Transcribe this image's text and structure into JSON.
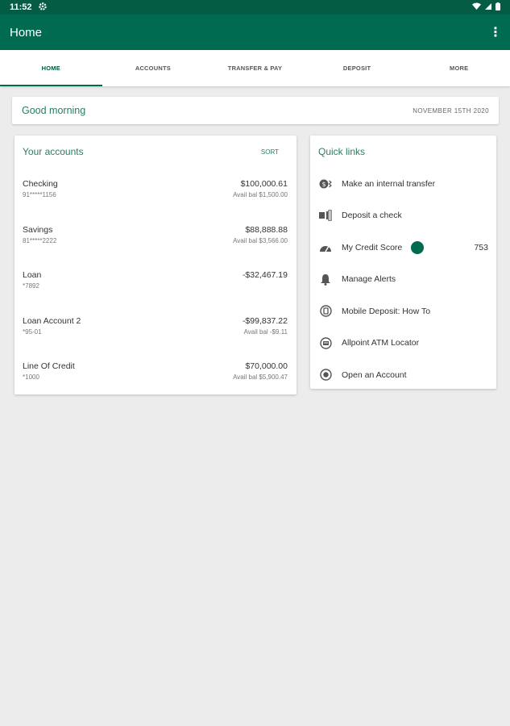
{
  "status_bar": {
    "time": "11:52"
  },
  "app_bar": {
    "title": "Home"
  },
  "tabs": [
    {
      "label": "HOME",
      "active": true
    },
    {
      "label": "ACCOUNTS"
    },
    {
      "label": "TRANSFER & PAY"
    },
    {
      "label": "DEPOSIT"
    },
    {
      "label": "MORE"
    }
  ],
  "greeting": {
    "text": "Good morning",
    "date": "NOVEMBER 15TH 2020"
  },
  "accounts": {
    "title": "Your accounts",
    "sort_label": "SORT",
    "items": [
      {
        "name": "Checking",
        "number": "91*****1156",
        "amount": "$100,000.61",
        "avail": "Avail bal $1,500.00"
      },
      {
        "name": "Savings",
        "number": "81*****2222",
        "amount": "$88,888.88",
        "avail": "Avail bal $3,566.00"
      },
      {
        "name": "Loan",
        "number": "*7892",
        "amount": "-$32,467.19",
        "avail": ""
      },
      {
        "name": "Loan Account 2",
        "number": "*95-01",
        "amount": "-$99,837.22",
        "avail": "Avail bal -$9.11"
      },
      {
        "name": "Line Of Credit",
        "number": "*1000",
        "amount": "$70,000.00",
        "avail": "Avail bal $5,900.47"
      }
    ]
  },
  "quick_links": {
    "title": "Quick links",
    "items": [
      {
        "label": "Make an internal transfer",
        "icon": "transfer-icon"
      },
      {
        "label": "Deposit a check",
        "icon": "check-deposit-icon"
      },
      {
        "label": "My Credit Score",
        "icon": "gauge-icon",
        "value": "753"
      },
      {
        "label": "Manage Alerts",
        "icon": "bell-icon"
      },
      {
        "label": "Mobile Deposit: How To",
        "icon": "mobile-deposit-icon"
      },
      {
        "label": "Allpoint ATM Locator",
        "icon": "atm-icon"
      },
      {
        "label": "Open an Account",
        "icon": "plus-circle-icon"
      }
    ]
  },
  "colors": {
    "primary": "#006b50",
    "status_bar": "#055c44",
    "accent_text": "#2e7c5f"
  }
}
